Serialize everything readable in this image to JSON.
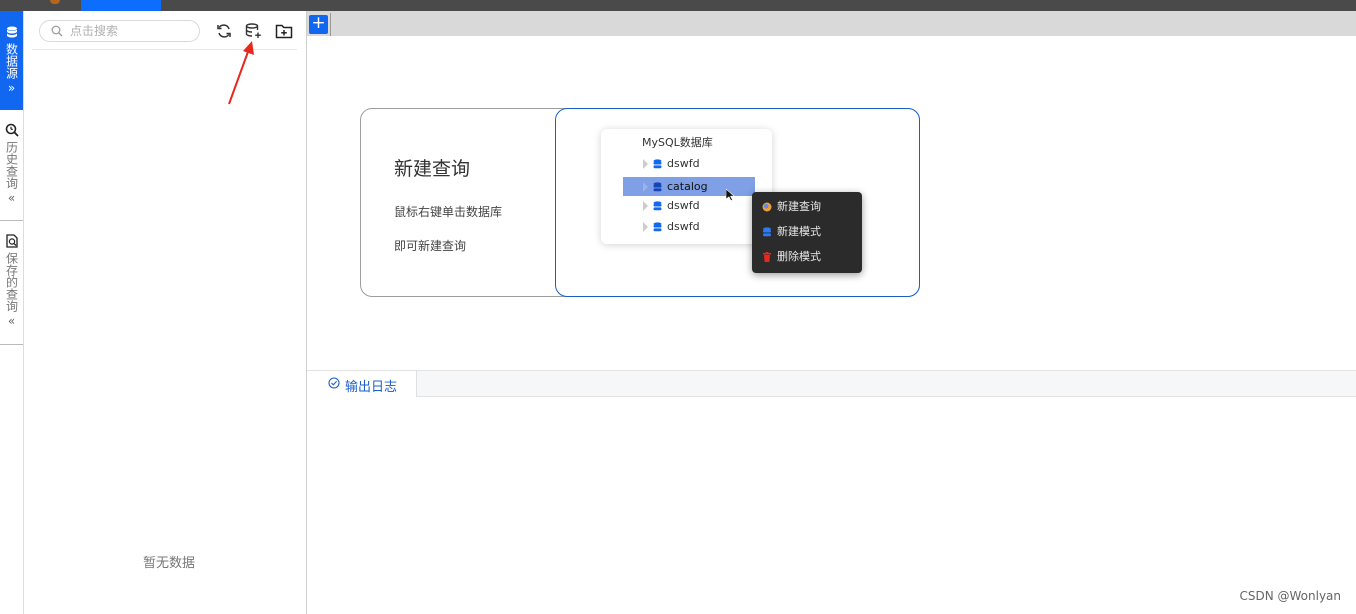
{
  "colors": {
    "primary": "#1267f0",
    "card_border": "#1a5fc8",
    "annotation": "#e8271f",
    "delete": "#e8271f"
  },
  "vnav": [
    {
      "label": "数据源",
      "chevron": "»",
      "active": true
    },
    {
      "label": "历史查询",
      "chevron": "«",
      "active": false
    },
    {
      "label": "保存的查询",
      "chevron": "«",
      "active": false
    }
  ],
  "sidebar": {
    "search_placeholder": "点击搜索",
    "tools": [
      "refresh-icon",
      "add-datasource-icon",
      "new-folder-icon"
    ],
    "empty_text": "暂无数据"
  },
  "tabs": {
    "add_label": "+"
  },
  "guide": {
    "title": "新建查询",
    "line1": "鼠标右键单击数据库",
    "line2": "即可新建查询",
    "tree": {
      "root": "MySQL数据库",
      "items": [
        "dswfd",
        "catalog",
        "dswfd",
        "dswfd"
      ],
      "selected_index": 1
    },
    "context_menu": [
      "新建查询",
      "新建模式",
      "删除模式"
    ]
  },
  "bottom": {
    "tab_label": "输出日志"
  },
  "watermark": "CSDN @Wonlyan"
}
